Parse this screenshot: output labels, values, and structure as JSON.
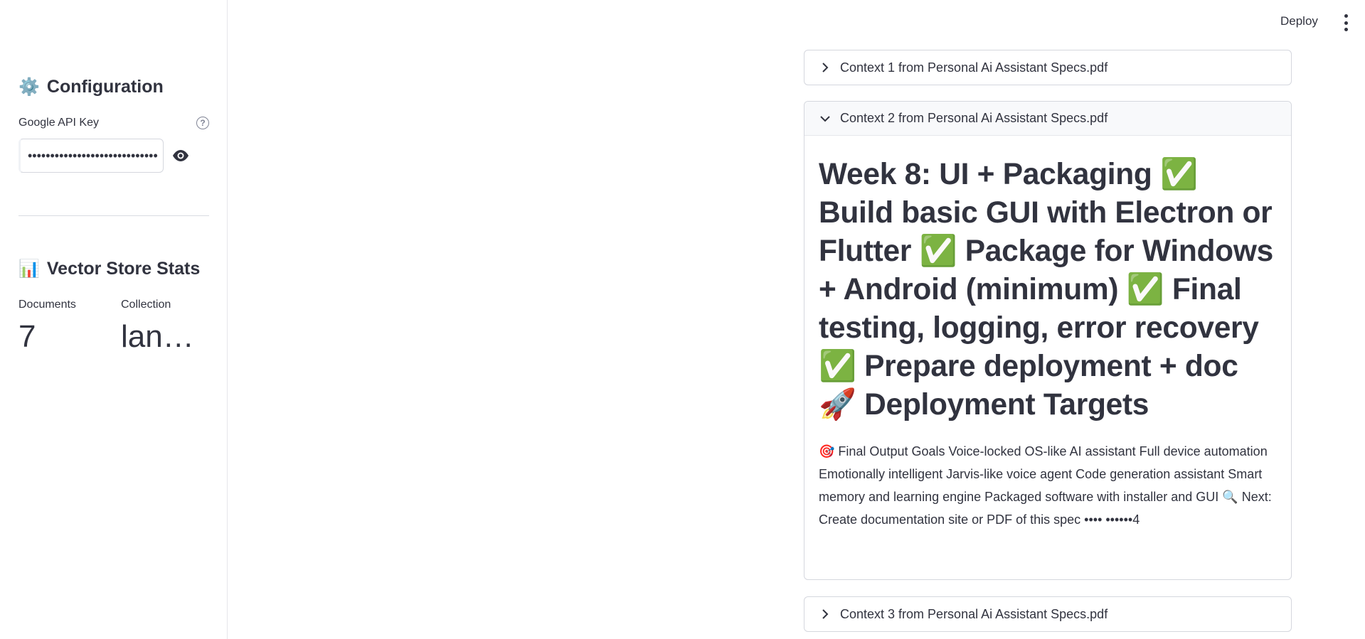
{
  "header": {
    "deploy_label": "Deploy",
    "menu_icon": "kebab-menu-icon"
  },
  "sidebar": {
    "config_emoji": "⚙️",
    "config_title": "Configuration",
    "api_key_label": "Google API Key",
    "api_key_value": "•••••••••••••••••••••••••••••",
    "stats_emoji": "📊",
    "stats_title": "Vector Store Stats",
    "metrics": [
      {
        "label": "Documents",
        "value": "7"
      },
      {
        "label": "Collection",
        "value": "lang…"
      }
    ]
  },
  "main": {
    "expanders": [
      {
        "title": "Context 1 from Personal Ai Assistant Specs.pdf",
        "expanded": false
      },
      {
        "title": "Context 2 from Personal Ai Assistant Specs.pdf",
        "expanded": true,
        "heading": "Week 8: UI + Packaging ✅ Build basic GUI with Electron or Flutter ✅ Package for Windows + Android (minimum) ✅ Final testing, logging, error recovery ✅ Prepare deployment + doc 🚀 Deployment Targets",
        "body": "🎯 Final Output Goals Voice-locked OS-like AI assistant Full device automation Emotionally intelligent Jarvis-like voice agent Code generation assistant Smart memory and learning engine Packaged software with installer and GUI 🔍 Next: Create documentation site or PDF of this spec •••• ••••••4"
      },
      {
        "title": "Context 3 from Personal Ai Assistant Specs.pdf",
        "expanded": false
      }
    ]
  }
}
